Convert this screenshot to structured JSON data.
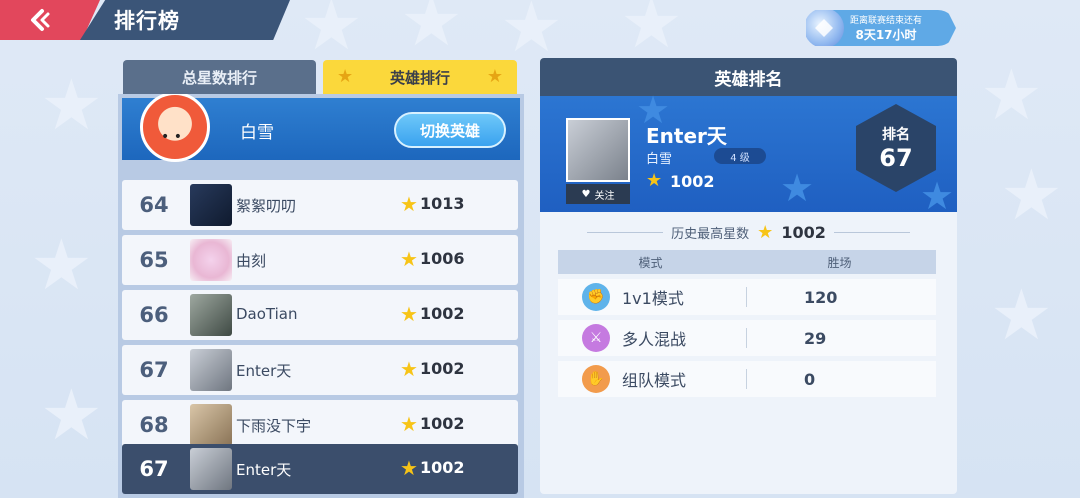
{
  "header": {
    "title": "排行榜"
  },
  "season": {
    "line1": "距离联赛结束还有",
    "line2": "8天17小时"
  },
  "tabs": [
    {
      "label": "总星数排行"
    },
    {
      "label": "英雄排行"
    }
  ],
  "hero": {
    "name": "白雪",
    "switch_label": "切换英雄"
  },
  "leaderboard": [
    {
      "rank": "64",
      "name": "絮絮叨叨",
      "score": "1013"
    },
    {
      "rank": "65",
      "name": "由刻",
      "score": "1006"
    },
    {
      "rank": "66",
      "name": "DaoTian",
      "score": "1002"
    },
    {
      "rank": "67",
      "name": "Enter天",
      "score": "1002"
    },
    {
      "rank": "68",
      "name": "下雨没下宇",
      "score": "1002"
    }
  ],
  "my_row": {
    "rank": "67",
    "name": "Enter天",
    "score": "1002"
  },
  "hero_rank": {
    "title": "英雄排名",
    "player_name": "Enter天",
    "hero_name": "白雪",
    "level": "4 级",
    "score": "1002",
    "follow_label": "关注",
    "rank_label": "排名",
    "rank_value": "67",
    "history_label": "历史最高星数",
    "history_value": "1002",
    "col_mode": "模式",
    "col_wins": "胜场",
    "modes": [
      {
        "name": "1v1模式",
        "wins": "120",
        "icon": "fist-icon",
        "color": "#5fb3ea"
      },
      {
        "name": "多人混战",
        "wins": "29",
        "icon": "crossed-swords-icon",
        "color": "#c57ae0"
      },
      {
        "name": "组队模式",
        "wins": "0",
        "icon": "handshake-icon",
        "color": "#f29b4c"
      }
    ]
  }
}
